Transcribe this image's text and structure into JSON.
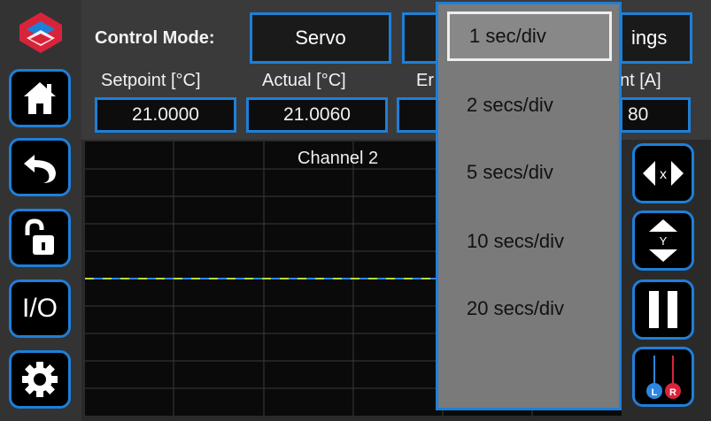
{
  "control_mode": {
    "label": "Control Mode:",
    "value": "Servo",
    "settings_partial": "ings"
  },
  "readouts": [
    {
      "label": "Setpoint [°C]",
      "value": "21.0000"
    },
    {
      "label": "Actual [°C]",
      "value": "21.0060"
    },
    {
      "label": "Er",
      "value": ""
    },
    {
      "label": "nt [A]",
      "value": "80"
    }
  ],
  "chart": {
    "title": "Channel 2",
    "trace_colors": [
      "#2d86e0",
      "#b6d83c"
    ]
  },
  "sidebar": {
    "io_label": "I/O"
  },
  "right_controls": {
    "x_label": "x",
    "y_label": "Y",
    "left_label": "L",
    "right_label": "R"
  },
  "timebase_dropdown": {
    "options": [
      "1 sec/div",
      "2 secs/div",
      "5 secs/div",
      "10 secs/div",
      "20 secs/div"
    ],
    "selected": "1 sec/div"
  },
  "colors": {
    "accent": "#1e7fd8",
    "dropdown_bg": "#7a7a7a"
  }
}
